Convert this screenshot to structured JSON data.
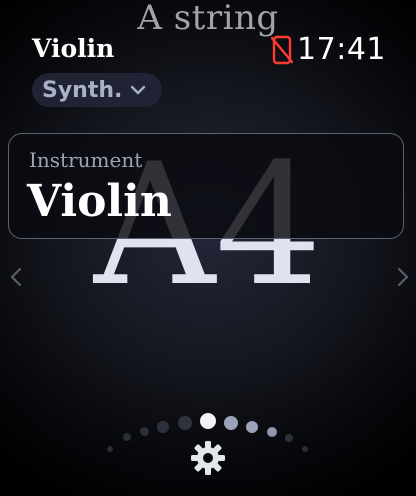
{
  "header": {
    "string_label": "A string",
    "title": "Violin",
    "time": "17:41",
    "status_icon": "phone-off-icon",
    "status_color": "#ff3b30"
  },
  "sound_selector": {
    "label": "Synth.",
    "icon": "chevron-down-icon"
  },
  "tuner": {
    "note": "A4"
  },
  "instrument_card": {
    "label": "Instrument",
    "value": "Violin"
  },
  "nav": {
    "left_icon": "chevron-left-icon",
    "right_icon": "chevron-right-icon"
  },
  "settings": {
    "icon": "gear-icon"
  }
}
